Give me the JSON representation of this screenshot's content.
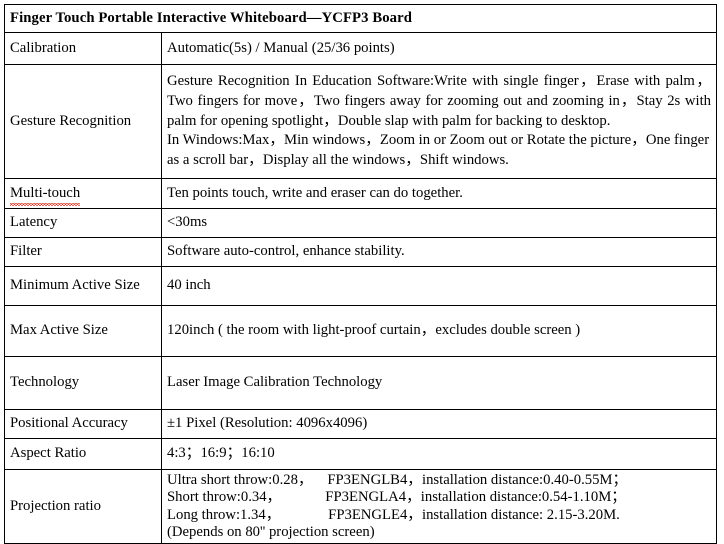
{
  "document": {
    "title": "Finger Touch Portable Interactive Whiteboard—YCFP3 Board"
  },
  "rows": [
    {
      "label": "Calibration",
      "value": "Automatic(5s) / Manual (25/36 points)"
    },
    {
      "label": "Gesture Recognition",
      "paragraphs": [
        "Gesture Recognition In Education Software:Write with single finger，Erase with palm，Two fingers for move，Two fingers away for zooming out and zooming in，Stay 2s with palm for opening spotlight，Double slap with palm for backing to desktop.",
        "In Windows:Max，Min windows，Zoom in or Zoom out or Rotate the picture，One finger as a scroll bar，Display all the windows，Shift windows."
      ]
    },
    {
      "label": "Multi-touch",
      "label_misspelled": true,
      "value": "Ten points touch, write and eraser can do together."
    },
    {
      "label": "Latency",
      "value": "<30ms"
    },
    {
      "label": "Filter",
      "value": "Software auto-control, enhance stability."
    },
    {
      "label": "Minimum Active Size",
      "value": "40 inch"
    },
    {
      "label": "Max Active Size",
      "value": "120inch ( the room with light-proof curtain，excludes double screen )"
    },
    {
      "label": "Technology",
      "value": "Laser Image Calibration Technology"
    },
    {
      "label": "Positional Accuracy",
      "value": "±1 Pixel (Resolution: 4096x4096)"
    },
    {
      "label": "Aspect Ratio",
      "value": "4:3；16:9；16:10"
    },
    {
      "label": "Projection ratio",
      "lines": [
        "Ultra short throw:0.28，    FP3ENGLB4，installation distance:0.40-0.55M；",
        "Short throw:0.34，            FP3ENGLA4，installation distance:0.54-1.10M；",
        "Long throw:1.34，             FP3ENGLE4，installation distance: 2.15-3.20M.",
        "(Depends on 80'' projection screen)"
      ]
    }
  ],
  "colors": {
    "text": "#000000",
    "border": "#000000",
    "background": "#ffffff",
    "spellcheck_underline": "#d43b2a"
  }
}
